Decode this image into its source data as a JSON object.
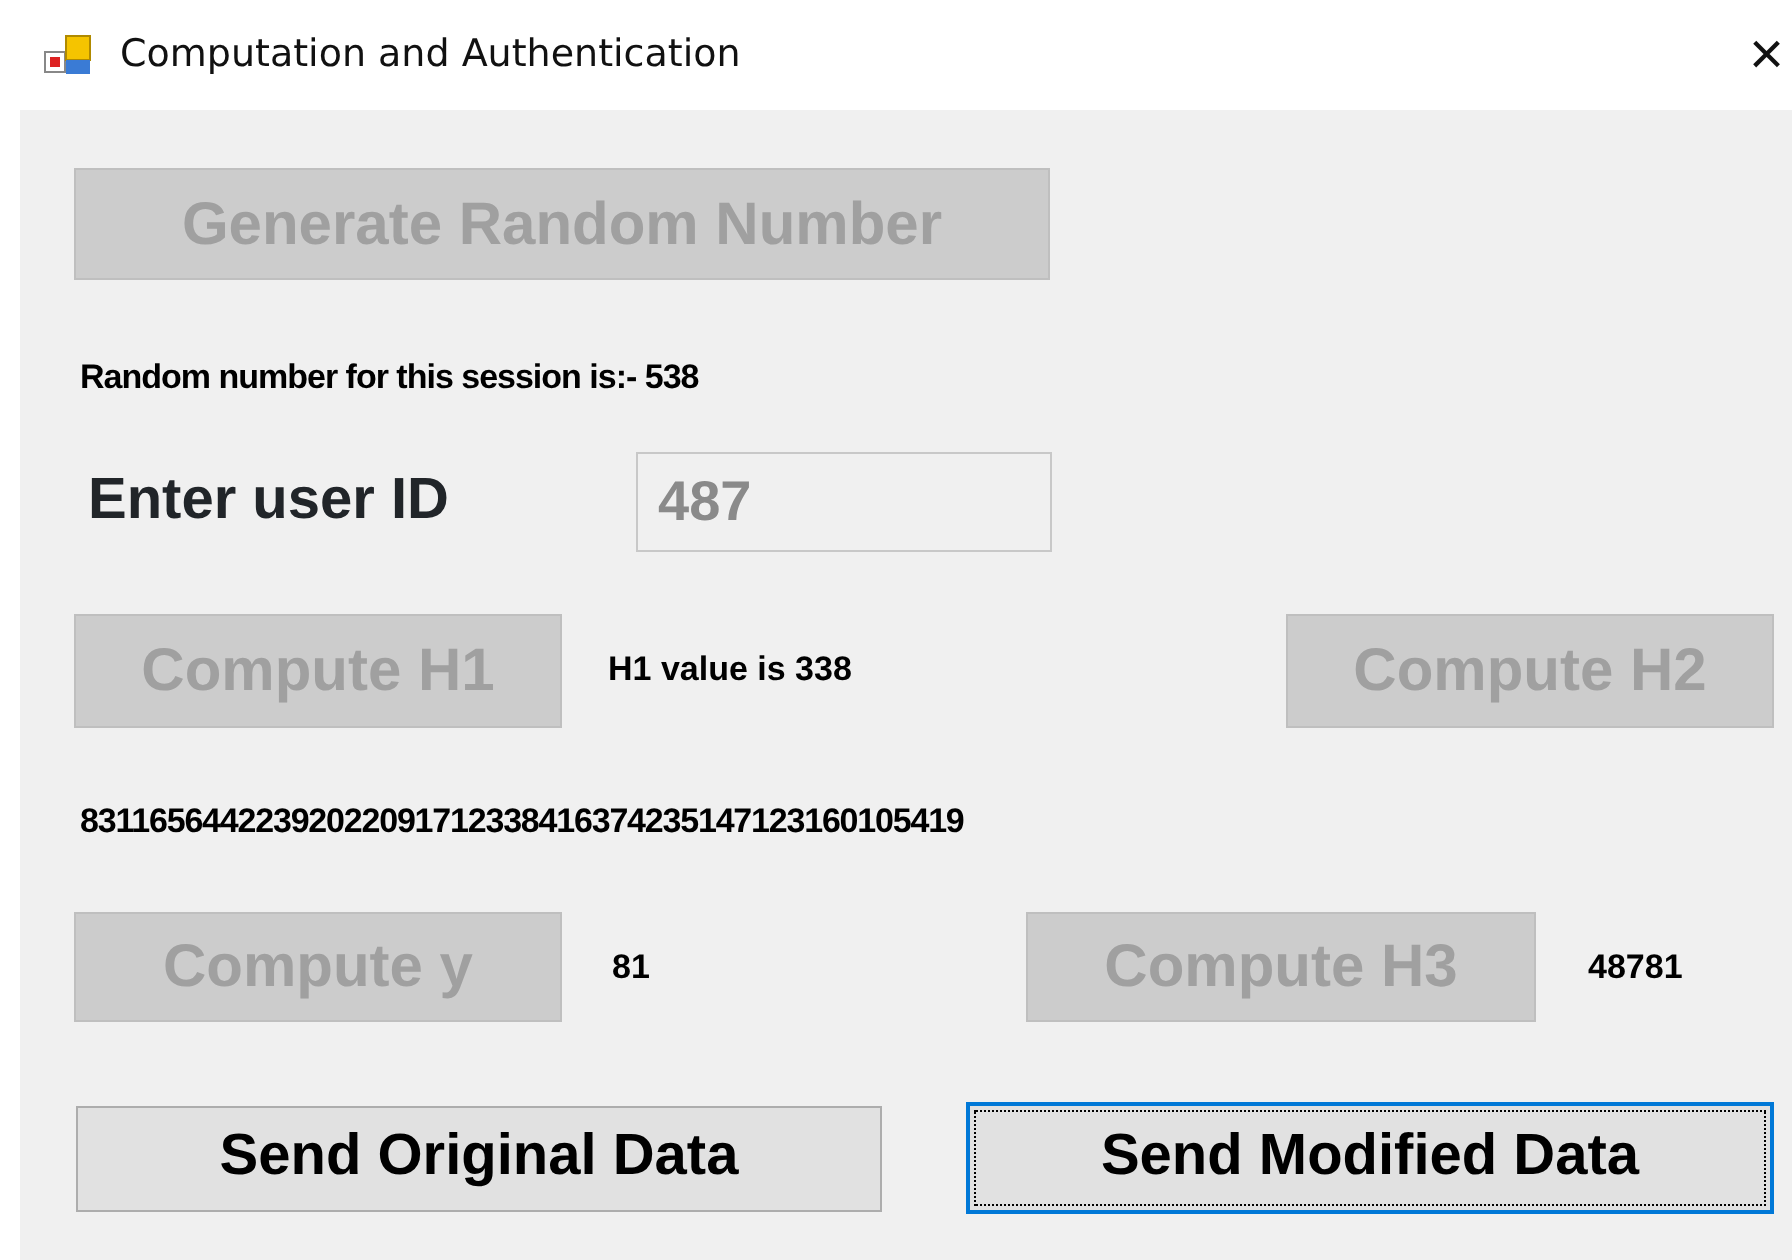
{
  "window": {
    "title": "Computation and Authentication",
    "close": "×"
  },
  "generate_button": {
    "label": "Generate Random Number",
    "disabled": true
  },
  "random_label": "Random number for this session is:- 538",
  "user_id": {
    "label": "Enter user ID",
    "value": "487",
    "disabled": true
  },
  "h1_row": {
    "button": {
      "label": "Compute H1",
      "disabled": true
    },
    "result": "H1 value is 338",
    "button_2": {
      "label": "Compute H2",
      "disabled": true
    }
  },
  "long_number": "83116564422392022091712338416374235147123160105419",
  "y_row": {
    "button": {
      "label": "Compute y",
      "disabled": true
    },
    "result": "81",
    "button_2": {
      "label": "Compute H3",
      "disabled": true
    },
    "result_2": "48781"
  },
  "send_buttons": [
    {
      "label": "Send Original Data",
      "focused": false
    },
    {
      "label": "Send Modified Data",
      "focused": true
    }
  ]
}
